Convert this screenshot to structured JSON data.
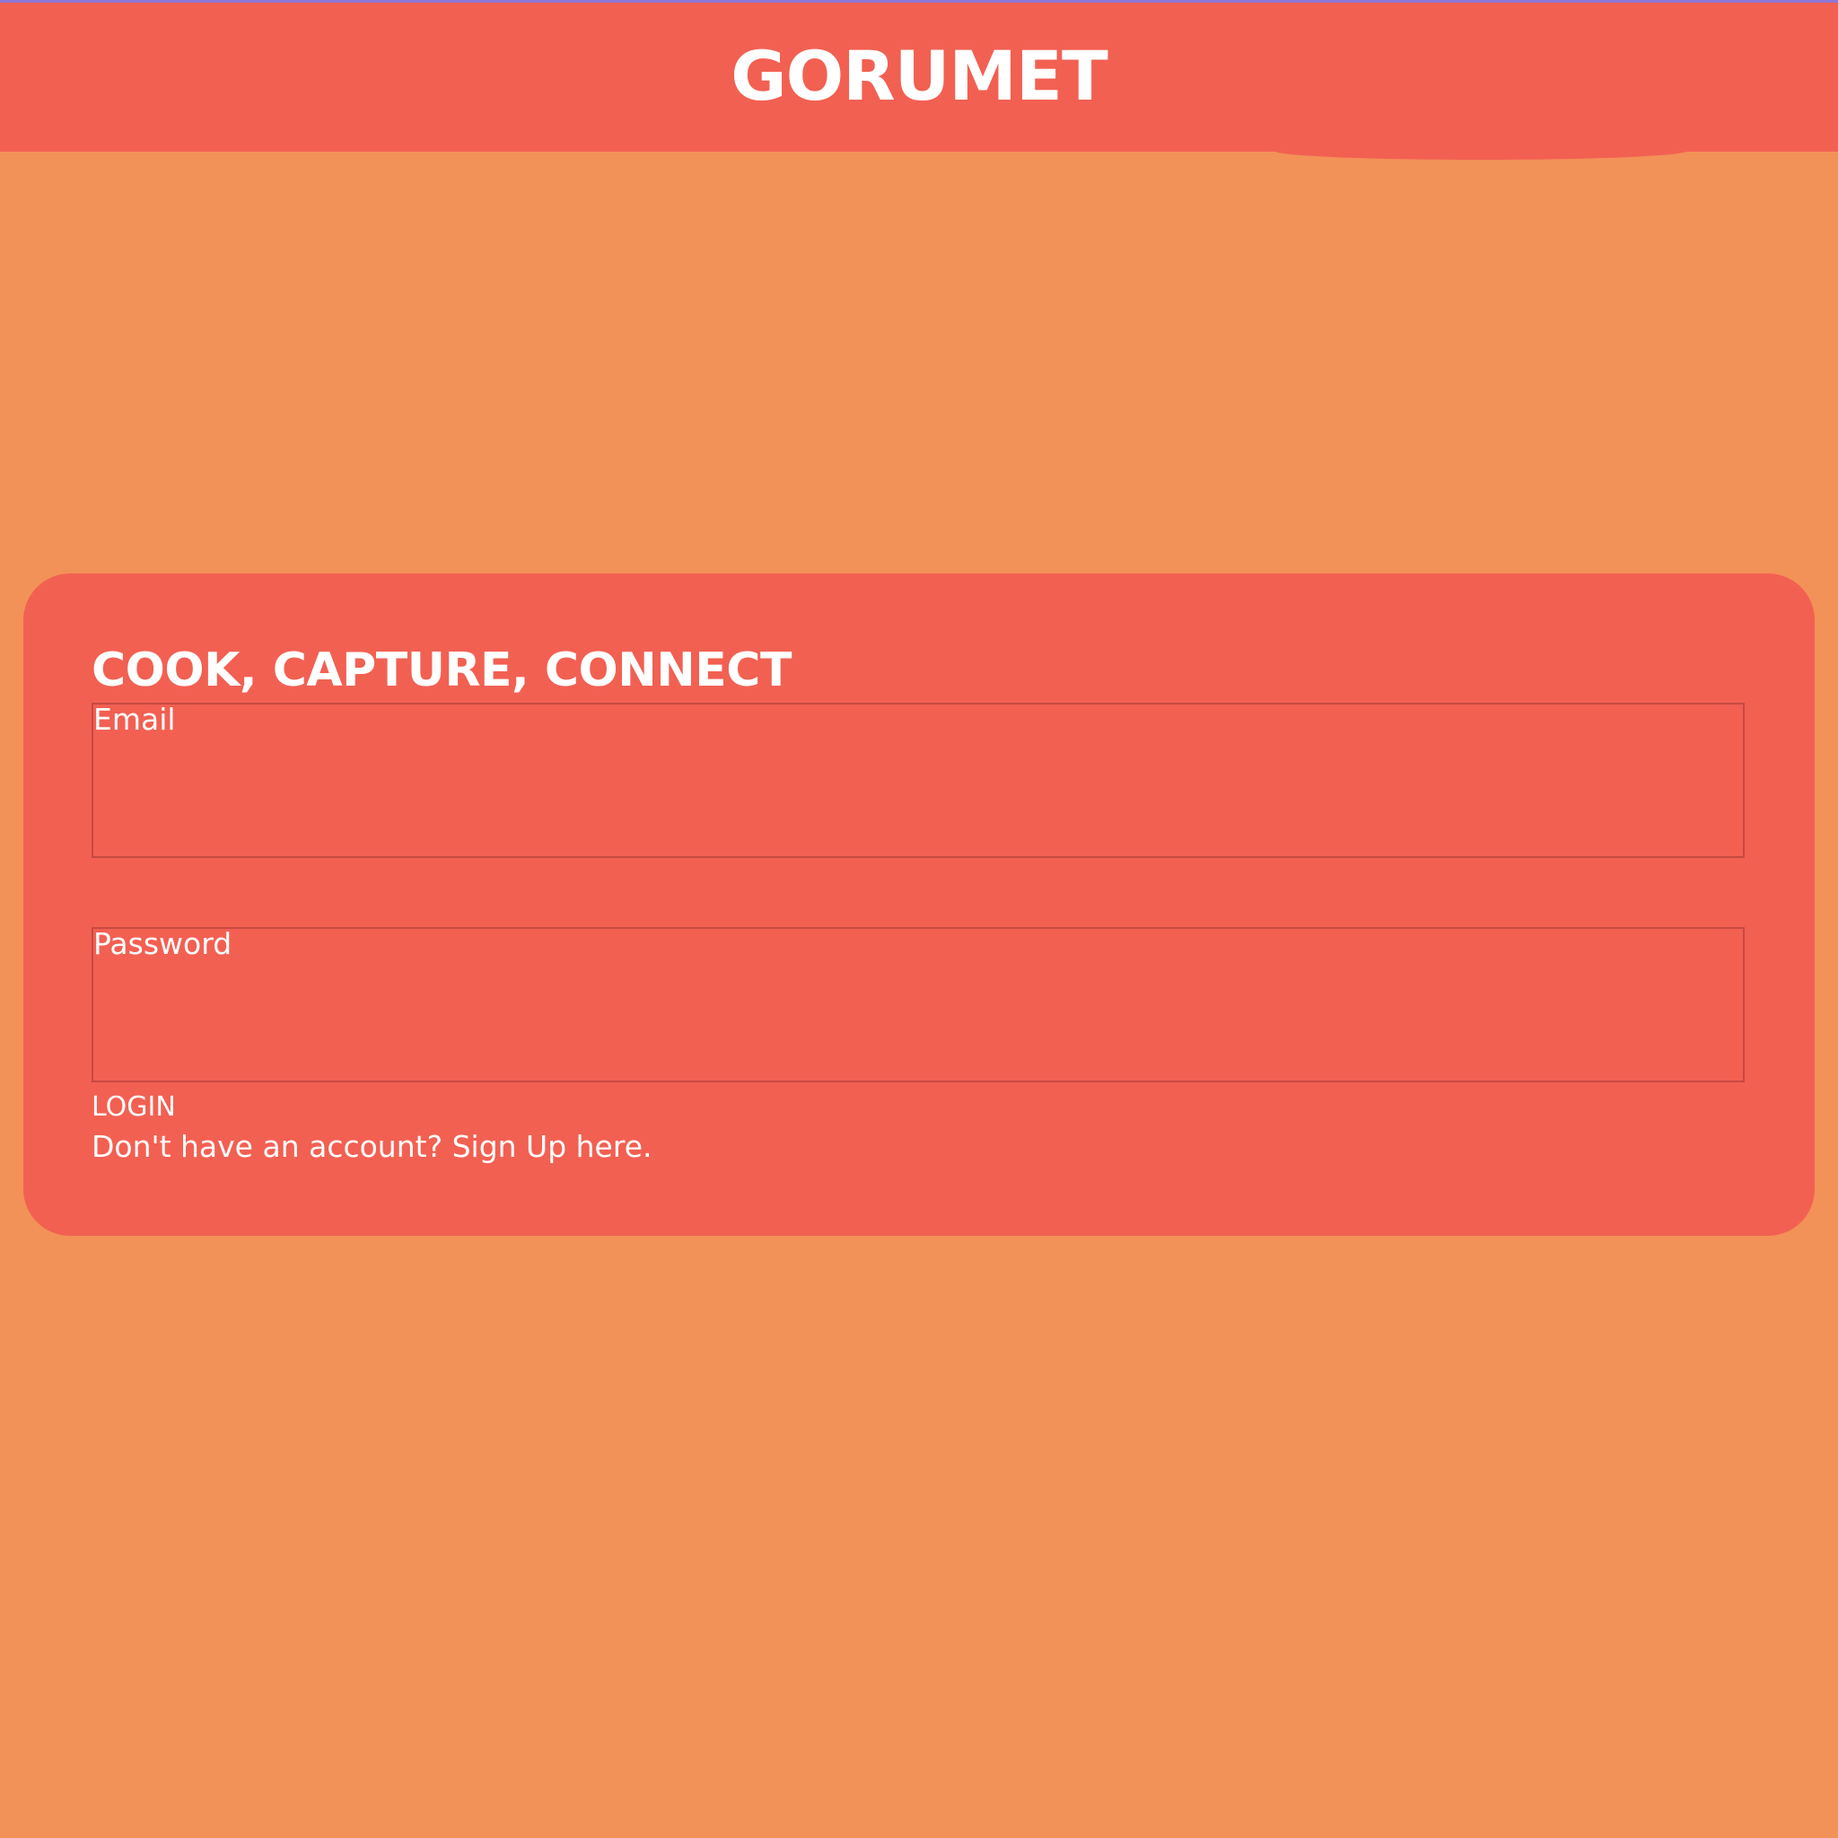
{
  "header": {
    "brand": "GORUMET"
  },
  "login_card": {
    "title": "COOK, CAPTURE, CONNECT",
    "email": {
      "label": "Email",
      "value": ""
    },
    "password": {
      "label": "Password",
      "value": ""
    },
    "login_button": "LOGIN",
    "signup_prompt": "Don't have an account? Sign Up here."
  },
  "colors": {
    "page_background": "#F29158",
    "header_background": "#F26052",
    "card_background": "#F26052",
    "field_border": "#C64A42",
    "text": "#FFFFFF"
  }
}
